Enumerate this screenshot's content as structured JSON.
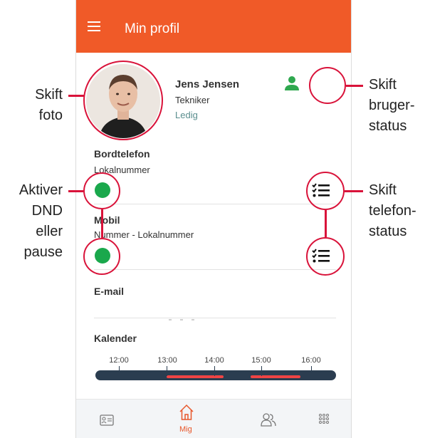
{
  "appbar": {
    "title": "Min profil",
    "icon": "hamburger-menu-icon"
  },
  "profile": {
    "name": "Jens Jensen",
    "role": "Tekniker",
    "status": "Ledig"
  },
  "phones": [
    {
      "title": "Bordtelefon",
      "subtitle": "Lokalnummer",
      "status_color": "#1aa84c"
    },
    {
      "title": "Mobil",
      "subtitle": "Nummer - Lokalnummer",
      "status_color": "#1aa84c"
    }
  ],
  "email": {
    "title": "E-mail"
  },
  "calendar": {
    "title": "Kalender",
    "ticks": [
      "12:00",
      "13:00",
      "14:00",
      "15:00",
      "16:00"
    ]
  },
  "bottom_nav": {
    "active_label": "Mig"
  },
  "callouts": {
    "photo": [
      "Skift",
      "foto"
    ],
    "user_status": [
      "Skift",
      "bruger-",
      "status"
    ],
    "dnd": [
      "Aktiver",
      "DND",
      "eller",
      "pause"
    ],
    "phone_status": [
      "Skift",
      "telefon-",
      "status"
    ]
  },
  "colors": {
    "accent": "#f05a28",
    "callout": "#d9133a",
    "available": "#1aa84c",
    "busy": "#ef4444"
  }
}
